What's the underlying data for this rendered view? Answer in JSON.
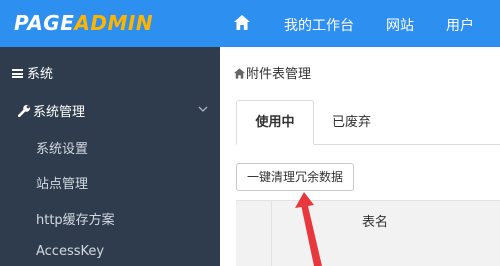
{
  "header": {
    "logo_part1": "PAGE",
    "logo_part2": "ADMIN",
    "nav": {
      "workspace": "我的工作台",
      "site": "网站",
      "user": "用户"
    }
  },
  "sidebar": {
    "section_label": "系统",
    "group_label": "系统管理",
    "items": [
      {
        "label": "系统设置"
      },
      {
        "label": "站点管理"
      },
      {
        "label": "http缓存方案"
      },
      {
        "label": "AccessKey"
      }
    ]
  },
  "main": {
    "breadcrumb": "附件表管理",
    "tabs": [
      {
        "label": "使用中",
        "active": true
      },
      {
        "label": "已废弃",
        "active": false
      }
    ],
    "clean_button": "一键清理冗余数据",
    "table": {
      "col_name": "表名"
    }
  },
  "colors": {
    "topbar": "#2d8ff0",
    "sidebar": "#2f3c4d",
    "logo_accent": "#ffb400",
    "arrow": "#e8383d"
  },
  "icons": [
    "home-icon",
    "menu-icon",
    "wrench-icon",
    "chevron-down-icon",
    "breadcrumb-home-icon"
  ]
}
